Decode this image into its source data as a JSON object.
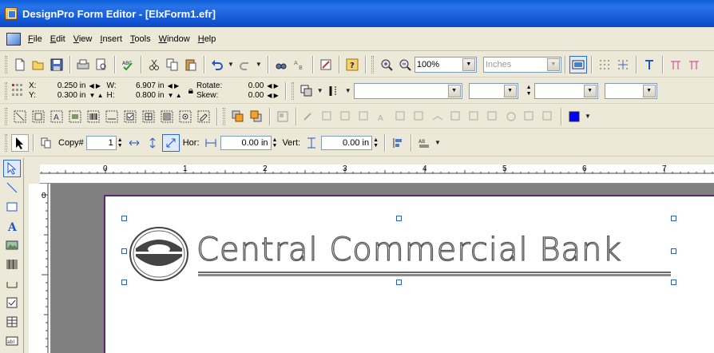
{
  "window": {
    "title": "DesignPro Form Editor - [ElxForm1.efr]"
  },
  "menu": {
    "items": [
      "File",
      "Edit",
      "View",
      "Insert",
      "Tools",
      "Window",
      "Help"
    ]
  },
  "toolbar": {
    "zoom": "100%",
    "units": "Inches"
  },
  "position": {
    "x_label": "X:",
    "x_value": "0.250 in",
    "y_label": "Y:",
    "y_value": "0.300 in",
    "w_label": "W:",
    "w_value": "6.907 in",
    "h_label": "H:",
    "h_value": "0.800 in",
    "rotate_label": "Rotate:",
    "rotate_value": "0.00",
    "skew_label": "Skew:",
    "skew_value": "0.00"
  },
  "copy_bar": {
    "copy_label": "Copy#",
    "copy_value": "1",
    "hor_label": "Hor:",
    "hor_value": "0.00 in",
    "vert_label": "Vert:",
    "vert_value": "0.00 in"
  },
  "ruler": {
    "h_labels": [
      "0",
      "1",
      "2",
      "3",
      "4",
      "5",
      "6",
      "7"
    ]
  },
  "document": {
    "bank_name": "Central Commercial Bank"
  },
  "colors": {
    "title_bar": "#0a5fd8",
    "page_border": "#5a2d6a",
    "selection_handle": "#2b5cc2",
    "fill_color": "#0000ff"
  }
}
